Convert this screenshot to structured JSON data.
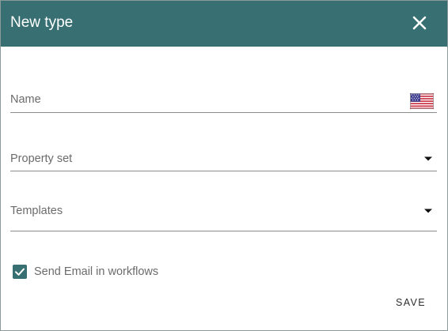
{
  "dialog": {
    "title": "New type",
    "close_icon": "close-icon"
  },
  "colors": {
    "header": "#376f73",
    "accent": "#376f73"
  },
  "form": {
    "name": {
      "label": "Name",
      "value": "",
      "language_icon": "us-flag-icon"
    },
    "property_set": {
      "label": "Property set",
      "value": ""
    },
    "templates": {
      "label": "Templates",
      "value": ""
    },
    "send_email": {
      "label": "Send Email in workflows",
      "checked": true
    }
  },
  "actions": {
    "save_label": "SAVE"
  }
}
